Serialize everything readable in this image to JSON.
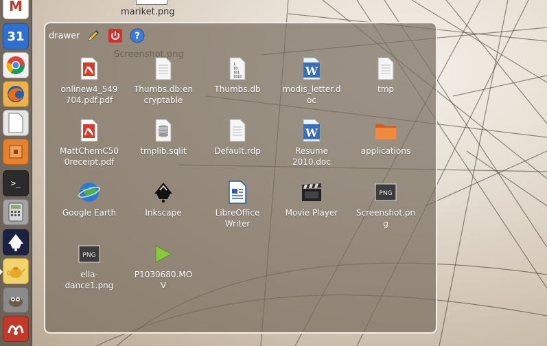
{
  "desktop": {
    "top_file_label": "mariket.png",
    "ghost_label": "Screenshot.png"
  },
  "launcher": {
    "items": [
      {
        "name": "gmail",
        "glyph": "M",
        "color": "#c0392b"
      },
      {
        "name": "calendar",
        "glyph": "31",
        "color": "#2f6fce"
      },
      {
        "name": "chrome",
        "glyph": "",
        "color": "#e9e9e9"
      },
      {
        "name": "firefox",
        "glyph": "",
        "color": "#e8700f"
      },
      {
        "name": "libreoffice",
        "glyph": "",
        "color": "#d9d9d9"
      },
      {
        "name": "files",
        "glyph": "",
        "color": "#e6822d"
      },
      {
        "name": "terminal",
        "glyph": ">_",
        "color": "#2b2b2b"
      },
      {
        "name": "calculator",
        "glyph": "",
        "color": "#9a9a9a"
      },
      {
        "name": "inkscape",
        "glyph": "",
        "color": "#2a3b6b"
      },
      {
        "name": "teapot",
        "glyph": "",
        "color": "#e7b73b"
      },
      {
        "name": "gimp",
        "glyph": "",
        "color": "#7b7b7b"
      },
      {
        "name": "mendeley",
        "glyph": "",
        "color": "#b72b2b"
      }
    ]
  },
  "drawer": {
    "title": "drawer",
    "items": [
      {
        "label": "onlinew4_549\n704.pdf.pdf",
        "icon": "pdf"
      },
      {
        "label": "Thumbs.db:en\ncryptable",
        "icon": "text"
      },
      {
        "label": "Thumbs.db",
        "icon": "binary"
      },
      {
        "label": "modis_letter.d\noc",
        "icon": "word"
      },
      {
        "label": "tmp",
        "icon": "text"
      },
      {
        "label": "MattChemC50\n0receipt.pdf",
        "icon": "pdf"
      },
      {
        "label": "tmplib.sqlit",
        "icon": "db"
      },
      {
        "label": "Default.rdp",
        "icon": "text"
      },
      {
        "label": "Resume\n2010.doc",
        "icon": "word"
      },
      {
        "label": "applications",
        "icon": "folder"
      },
      {
        "label": "Google Earth",
        "icon": "earth"
      },
      {
        "label": "Inkscape",
        "icon": "inkscape"
      },
      {
        "label": "LibreOffice\nWriter",
        "icon": "writer"
      },
      {
        "label": "Movie Player",
        "icon": "movie"
      },
      {
        "label": "Screenshot.pn\ng",
        "icon": "png"
      },
      {
        "label": "ella-\ndance1.png",
        "icon": "png"
      },
      {
        "label": "P1030680.MO\nV",
        "icon": "play"
      }
    ]
  },
  "icons": {
    "edit": "pencil-icon",
    "quit": "power-icon",
    "help": "help-icon"
  },
  "colors": {
    "drawer_bg": "#786e5f",
    "drawer_border": "#f2efe9",
    "accent_red": "#d62d2d",
    "help_blue": "#3b7cd6"
  }
}
